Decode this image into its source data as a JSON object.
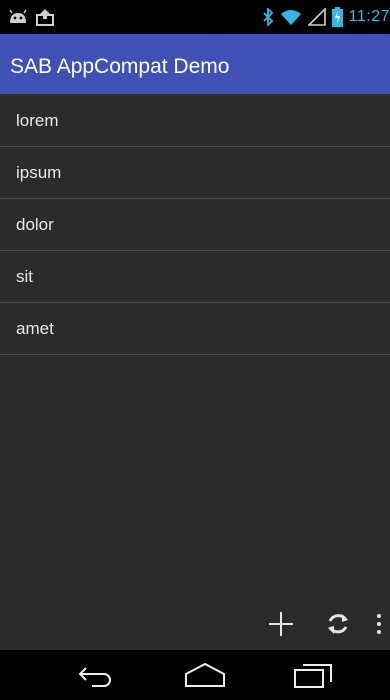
{
  "status_bar": {
    "time": "11:27",
    "icons_left": [
      "android-debug-icon",
      "upload-icon"
    ],
    "icons_right": [
      "bluetooth-icon",
      "wifi-icon",
      "signal-icon",
      "battery-charging-icon"
    ]
  },
  "action_bar": {
    "title": "SAB AppCompat Demo",
    "color": "#3f51b5"
  },
  "list": {
    "items": [
      "lorem",
      "ipsum",
      "dolor",
      "sit",
      "amet"
    ]
  },
  "split_action_bar": {
    "icons": [
      "add-icon",
      "refresh-icon",
      "overflow-menu-icon"
    ]
  },
  "nav_bar": {
    "icons": [
      "back-icon",
      "home-icon",
      "recent-apps-icon"
    ]
  },
  "colors": {
    "background": "#2b2b2b",
    "accent": "#35b6e5",
    "divider": "#4a4a4a"
  }
}
